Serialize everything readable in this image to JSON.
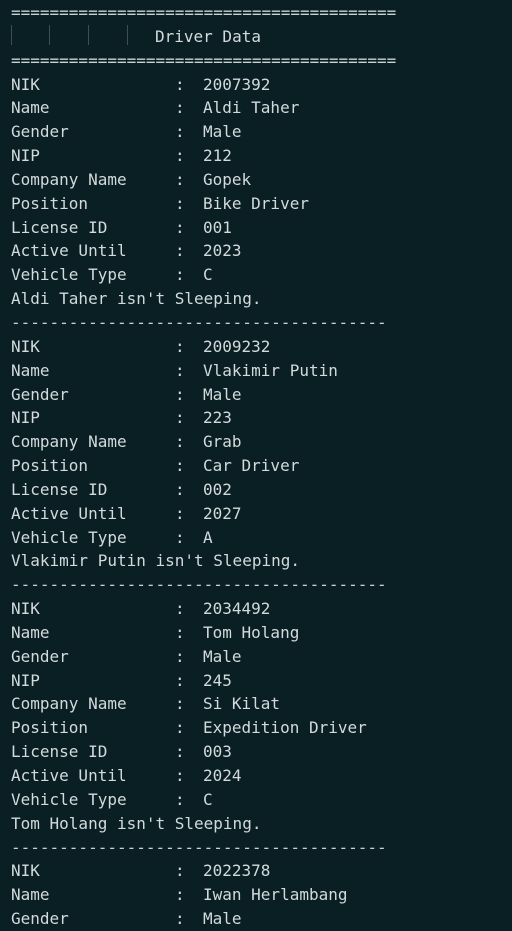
{
  "header": {
    "separator": "========================================",
    "title": "Driver Data"
  },
  "divider": "---------------------------------------",
  "labels": {
    "nik": "NIK",
    "name": "Name",
    "gender": "Gender",
    "nip": "NIP",
    "company": "Company Name",
    "position": "Position",
    "license": "License ID",
    "active": "Active Until",
    "vehicle": "Vehicle Type"
  },
  "colon": ":",
  "drivers": [
    {
      "nik": "2007392",
      "name": "Aldi Taher",
      "gender": "Male",
      "nip": "212",
      "company": "Gopek",
      "position": "Bike Driver",
      "license": "001",
      "active": "2023",
      "vehicle": "C",
      "status": "Aldi Taher isn't Sleeping."
    },
    {
      "nik": "2009232",
      "name": "Vlakimir Putin",
      "gender": "Male",
      "nip": "223",
      "company": "Grab",
      "position": "Car Driver",
      "license": "002",
      "active": "2027",
      "vehicle": "A",
      "status": "Vlakimir Putin isn't Sleeping."
    },
    {
      "nik": "2034492",
      "name": "Tom Holang",
      "gender": "Male",
      "nip": "245",
      "company": "Si Kilat",
      "position": "Expedition Driver",
      "license": "003",
      "active": "2024",
      "vehicle": "C",
      "status": "Tom Holang isn't Sleeping."
    },
    {
      "nik": "2022378",
      "name": "Iwan Herlambang",
      "gender": "Male"
    }
  ]
}
